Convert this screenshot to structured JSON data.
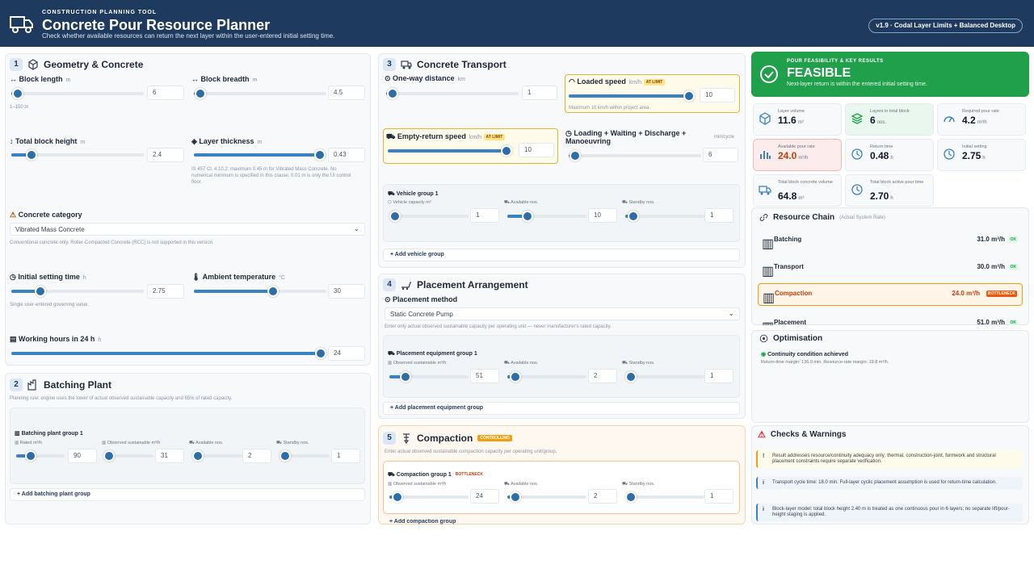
{
  "header": {
    "eyebrow": "CONSTRUCTION PLANNING TOOL",
    "title": "Concrete Pour Resource Planner",
    "subtitle": "Check whether available resources can return the next layer within the user-entered initial setting time.",
    "version": "v1.9 · Codal Layer Limits + Balanced Desktop"
  },
  "geometry": {
    "num": "1",
    "title": "Geometry & Concrete",
    "block_length": {
      "label": "Block length",
      "unit": "m",
      "value": "6",
      "hint": "1–150 m",
      "fraction": 0.05
    },
    "block_breadth": {
      "label": "Block breadth",
      "unit": "m",
      "value": "4.5",
      "fraction": 0.05
    },
    "total_height": {
      "label": "Total block height",
      "unit": "m",
      "value": "2.4",
      "fraction": 0.15
    },
    "layer_thickness": {
      "label": "Layer thickness",
      "unit": "m",
      "value": "0.43",
      "fraction": 0.95,
      "note": "IS 457 Cl. 4.10.2: maximum 0.45 m for Vibrated Mass Concrete. No numerical minimum is specified in this clause; 0.01 m is only the UI control floor."
    },
    "category": {
      "label": "Concrete category",
      "value": "Vibrated Mass Concrete",
      "note": "Conventional concrete only. Roller-Compacted Concrete (RCC) is not supported in this version."
    },
    "setting_time": {
      "label": "Initial setting time",
      "unit": "h",
      "value": "2.75",
      "hint": "Single user-entered governing value.",
      "fraction": 0.22
    },
    "ambient_temp": {
      "label": "Ambient temperature",
      "unit": "°C",
      "value": "30",
      "fraction": 0.6
    },
    "working_hours": {
      "label": "Working hours in 24 h",
      "unit": "h",
      "value": "24",
      "fraction": 1.0
    }
  },
  "batching": {
    "num": "2",
    "title": "Batching Plant",
    "desc": "Planning rule: engine uses the lower of actual observed sustainable capacity and 65% of rated capacity.",
    "group_title": "Batching plant group 1",
    "rated": {
      "label": "Rated m³/h",
      "value": "90",
      "fraction": 0.3
    },
    "observed": {
      "label": "Observed sustainable m³/h",
      "value": "31",
      "fraction": 0.1
    },
    "available": {
      "label": "Available nos.",
      "value": "2",
      "fraction": 0.1
    },
    "standby": {
      "label": "Standby nos.",
      "value": "1",
      "fraction": 0.05
    },
    "add": "+ Add batching plant group"
  },
  "transport": {
    "num": "3",
    "title": "Concrete Transport",
    "one_way": {
      "label": "One-way distance",
      "unit": "km",
      "value": "1",
      "fraction": 0.05
    },
    "loaded_speed": {
      "label": "Loaded speed",
      "unit": "km/h",
      "badge": "AT LIMIT",
      "value": "10",
      "hint": "Maximum 10 km/h within project area.",
      "fraction": 1.0
    },
    "empty_speed": {
      "label": "Empty-return speed",
      "unit": "km/h",
      "badge": "AT LIMIT",
      "value": "10",
      "fraction": 1.0
    },
    "loading": {
      "label": "Loading + Waiting + Discharge + Manoeuvring",
      "unit": "min/cycle",
      "value": "6",
      "fraction": 0.05
    },
    "group_title": "Vehicle group 1",
    "capacity": {
      "label": "Vehicle capacity m³",
      "value": "1",
      "fraction": 0.05
    },
    "available": {
      "label": "Available nos.",
      "value": "10",
      "fraction": 0.25
    },
    "standby": {
      "label": "Standby nos.",
      "value": "1",
      "fraction": 0.1
    },
    "add": "+ Add vehicle group"
  },
  "placement": {
    "num": "4",
    "title": "Placement Arrangement",
    "method_label": "Placement method",
    "method_value": "Static Concrete Pump",
    "desc": "Enter only actual observed sustainable capacity per operating unit — never manufacturer's rated capacity.",
    "group_title": "Placement equipment group 1",
    "observed": {
      "label": "Observed sustainable m³/h",
      "value": "51",
      "fraction": 0.2
    },
    "available": {
      "label": "Available nos.",
      "value": "2",
      "fraction": 0.1
    },
    "standby": {
      "label": "Standby nos.",
      "value": "1",
      "fraction": 0.05
    },
    "add": "+ Add placement equipment group"
  },
  "compaction": {
    "num": "5",
    "title": "Compaction",
    "badge": "CONTROLLING",
    "desc": "Enter actual observed sustainable compaction capacity per operating unit/group.",
    "group_title": "Compaction group 1",
    "group_badge": "BOTTLENECK",
    "observed": {
      "label": "Observed sustainable m³/h",
      "value": "24",
      "fraction": 0.1
    },
    "available": {
      "label": "Available nos.",
      "value": "2",
      "fraction": 0.1
    },
    "standby": {
      "label": "Standby nos.",
      "value": "1",
      "fraction": 0.05
    },
    "add": "+ Add compaction group"
  },
  "feasibility": {
    "eyebrow": "POUR FEASIBILITY & KEY RESULTS",
    "status": "FEASIBLE",
    "desc": "Next-layer return is within the entered initial setting time."
  },
  "metrics": [
    {
      "label": "Layer volume",
      "value": "11.6",
      "unit": "m³",
      "icon": "cube-icon"
    },
    {
      "label": "Layers in total block",
      "value": "6",
      "unit": "nos.",
      "icon": "layers-icon"
    },
    {
      "label": "Required pour rate",
      "value": "4.2",
      "unit": "m³/h",
      "icon": "gauge-icon"
    },
    {
      "label": "Available pour rate",
      "value": "24.0",
      "unit": "m³/h",
      "icon": "bar-chart-icon"
    },
    {
      "label": "Return time",
      "value": "0.48",
      "unit": "h",
      "icon": "clock-icon"
    },
    {
      "label": "Initial setting",
      "value": "2.75",
      "unit": "h",
      "icon": "clock-icon"
    },
    {
      "label": "Total block concrete volume",
      "value": "64.8",
      "unit": "m³",
      "icon": "truck-icon"
    },
    {
      "label": "Total block active pour time",
      "value": "2.70",
      "unit": "h",
      "icon": "clock-icon"
    }
  ],
  "resource_chain": {
    "title": "Resource Chain",
    "note": "(Actual System Rate)",
    "rows": [
      {
        "name": "Batching",
        "rate": "31.0 m³/h",
        "status": "OK"
      },
      {
        "name": "Transport",
        "rate": "30.0 m³/h",
        "status": "OK"
      },
      {
        "name": "Compaction",
        "rate": "24.0 m³/h",
        "status": "BOTTLENECK"
      },
      {
        "name": "Placement",
        "rate": "51.0 m³/h",
        "status": "OK"
      }
    ]
  },
  "optimisation": {
    "title": "Optimisation",
    "status": "Continuity condition achieved",
    "detail": "Return-time margin: 136.0 min. Resource-rate margin: 19.8 m³/h."
  },
  "checks": {
    "title": "Checks & Warnings",
    "items": [
      {
        "text": "Result addresses resource/continuity adequacy only; thermal, construction-joint, formwork and structural placement constraints require separate verification.",
        "kind": "warning"
      },
      {
        "text": "Transport cycle time: 18.0 min. Full-layer cyclic placement assumption is used for return-time calculation.",
        "kind": "info"
      },
      {
        "text": "Block-layer model: total block height 2.40 m is treated as one continuous pour in 6 layers; no separate lift/pour-height staging is applied.",
        "kind": "info"
      }
    ]
  },
  "colors": {
    "brand": "#1f3a5f",
    "accent": "#3b82c4",
    "success": "#20a04a",
    "warning": "#f59e0b"
  }
}
